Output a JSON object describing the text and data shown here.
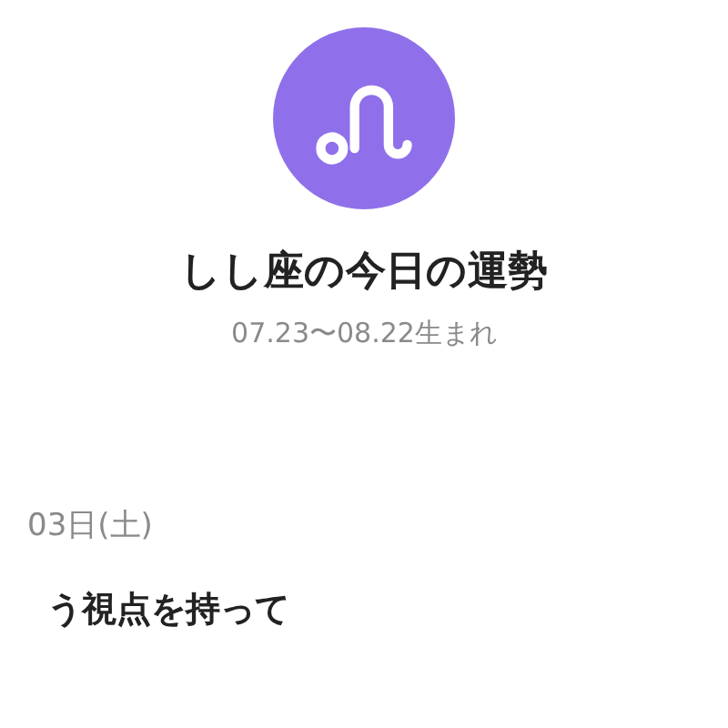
{
  "header": {
    "title": "しし座の今日の運勢",
    "period": "07.23〜08.22生まれ"
  },
  "fortune": {
    "date": "03日(土)",
    "headline": "う視点を持って"
  }
}
